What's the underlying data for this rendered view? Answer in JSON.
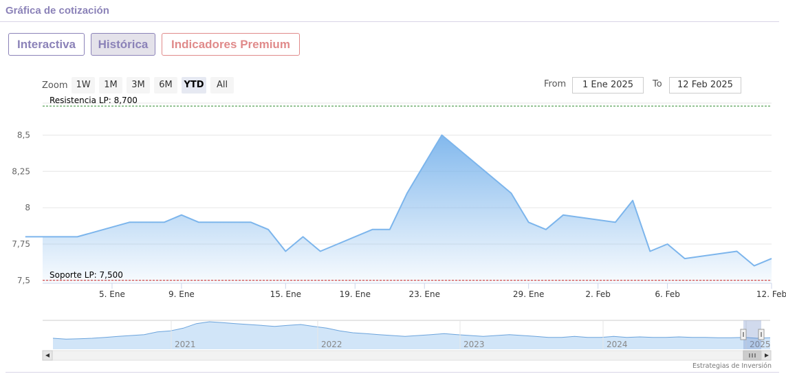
{
  "header": {
    "title": "Gráfica de cotización"
  },
  "tabs": [
    {
      "label": "Interactiva"
    },
    {
      "label": "Histórica"
    },
    {
      "label": "Indicadores Premium"
    }
  ],
  "toolbar": {
    "zoom_label": "Zoom",
    "zoom_buttons": [
      "1W",
      "1M",
      "3M",
      "6M",
      "YTD",
      "All"
    ],
    "active_zoom": "YTD",
    "from_label": "From",
    "from_value": "1 Ene 2025",
    "to_label": "To",
    "to_value": "12 Feb 2025"
  },
  "colors": {
    "line": "#7cb5ec",
    "resistance": "#2e8b2e",
    "support": "#cc2222",
    "accent": "#8b82b8"
  },
  "chart_data": {
    "type": "area",
    "ylim": [
      7.48,
      8.72
    ],
    "y_ticks": [
      "8,5",
      "8,25",
      "8",
      "7,75",
      "7,5"
    ],
    "x_tick_labels": [
      "5. Ene",
      "9. Ene",
      "15. Ene",
      "19. Ene",
      "23. Ene",
      "29. Ene",
      "2. Feb",
      "6. Feb",
      "12. Feb"
    ],
    "series": [
      {
        "dates": [
          "2024-12-31",
          "2025-01-02",
          "2025-01-03",
          "2025-01-06",
          "2025-01-07",
          "2025-01-08",
          "2025-01-09",
          "2025-01-10",
          "2025-01-13",
          "2025-01-14",
          "2025-01-15",
          "2025-01-16",
          "2025-01-17",
          "2025-01-20",
          "2025-01-21",
          "2025-01-22",
          "2025-01-23",
          "2025-01-24",
          "2025-01-27",
          "2025-01-28",
          "2025-01-29",
          "2025-01-30",
          "2025-01-31",
          "2025-02-03",
          "2025-02-04",
          "2025-02-05",
          "2025-02-06",
          "2025-02-07",
          "2025-02-10",
          "2025-02-11",
          "2025-02-12"
        ],
        "values": [
          7.8,
          7.8,
          7.8,
          7.9,
          7.9,
          7.9,
          7.95,
          7.9,
          7.9,
          7.85,
          7.7,
          7.8,
          7.7,
          7.85,
          7.85,
          8.1,
          8.3,
          8.5,
          8.2,
          8.1,
          7.9,
          7.85,
          7.95,
          7.9,
          8.05,
          7.7,
          7.75,
          7.65,
          7.7,
          7.6,
          7.65
        ]
      }
    ],
    "annotations": [
      {
        "label": "Resistencia LP: 8,700",
        "value": 8.7
      },
      {
        "label": "Soporte LP: 7,500",
        "value": 7.5
      }
    ],
    "navigator": {
      "year_labels": [
        "2021",
        "2022",
        "2023",
        "2024",
        "2025"
      ],
      "values": [
        1.2,
        1.1,
        1.15,
        1.2,
        1.3,
        1.4,
        1.5,
        1.6,
        1.9,
        2.0,
        2.3,
        2.8,
        3.0,
        2.9,
        2.8,
        2.7,
        2.6,
        2.5,
        2.6,
        2.7,
        2.5,
        2.3,
        2.0,
        1.8,
        1.7,
        1.6,
        1.5,
        1.4,
        1.5,
        1.6,
        1.7,
        1.6,
        1.5,
        1.4,
        1.5,
        1.6,
        1.5,
        1.4,
        1.3,
        1.3,
        1.4,
        1.3,
        1.3,
        1.4,
        1.3,
        1.35,
        1.3,
        1.3,
        1.35,
        1.3,
        1.3,
        1.25,
        1.25,
        1.3,
        1.2,
        1.25
      ]
    }
  },
  "credits": "Estrategias de Inversión"
}
